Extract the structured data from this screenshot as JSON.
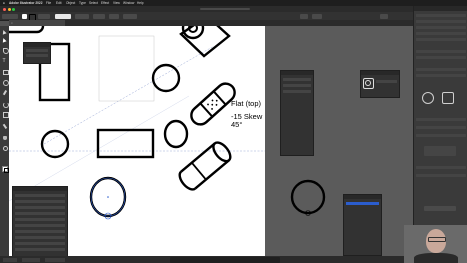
{
  "menubar": {
    "app_name": "Adobe Illustrator 2022",
    "items": [
      "File",
      "Edit",
      "Object",
      "Type",
      "Select",
      "Effect",
      "View",
      "Window",
      "Help"
    ]
  },
  "annotation": {
    "line1": "Flat (top)",
    "line2": "-15 Skew",
    "line3": "45°"
  },
  "panels": {
    "mini_panel_title": "",
    "layers_panel_title": "",
    "navigator_panel_title": "",
    "swatches_panel_title": ""
  },
  "icons": {
    "toolbar": [
      "selection-icon",
      "direct-selection-icon",
      "pen-icon",
      "type-icon",
      "rectangle-icon",
      "ellipse-icon",
      "brush-icon",
      "rotate-icon",
      "scale-icon",
      "eyedropper-icon",
      "hand-icon",
      "zoom-icon"
    ]
  },
  "colors": {
    "ui_dark": "#323232",
    "canvas": "#ffffff",
    "pasteboard": "#5b5b5b",
    "selection": "#2b5dcd",
    "stroke": "#000000"
  }
}
